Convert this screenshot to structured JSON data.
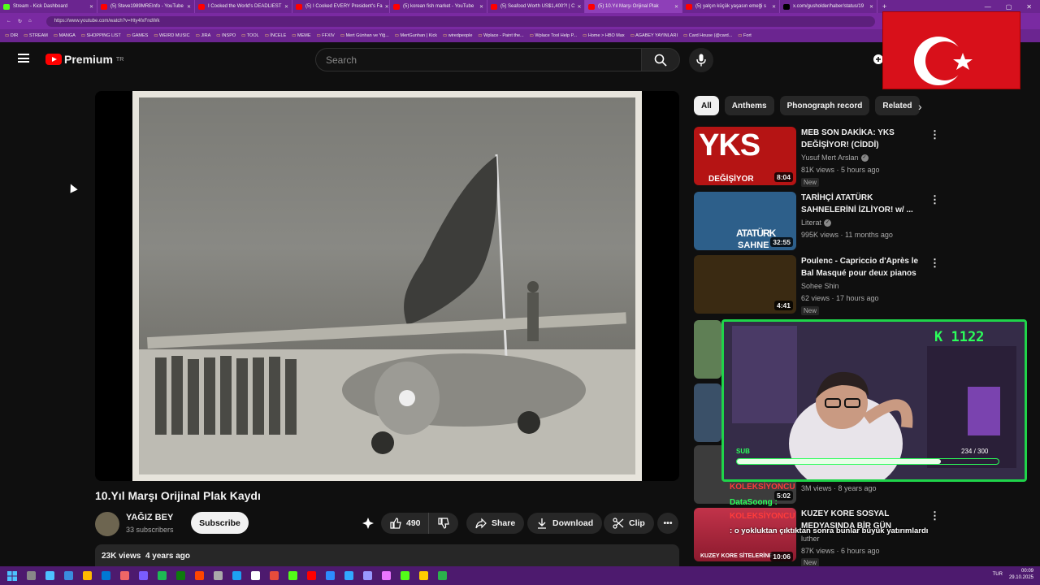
{
  "browser": {
    "tabs": [
      {
        "title": "Stream - Kick Dashboard",
        "color": "#53fc18"
      },
      {
        "title": "(5) Steve1989MREInfo - YouTube",
        "color": "#ff0000"
      },
      {
        "title": "I Cooked the World's DEADLIEST",
        "color": "#ff0000"
      },
      {
        "title": "(5) I Cooked EVERY President's Fa",
        "color": "#ff0000"
      },
      {
        "title": "(5) korean fish market - YouTube",
        "color": "#ff0000"
      },
      {
        "title": "(5) Seafood Worth US$1,400?! | C",
        "color": "#ff0000"
      },
      {
        "title": "(5) 10.Yıl Marşı Orijinal Plak",
        "color": "#ff0000"
      },
      {
        "title": "(5) yalçın küçük yaşasın emeği s",
        "color": "#ff0000"
      },
      {
        "title": "x.com/gusholder/haber/status/19",
        "color": "#000000"
      }
    ],
    "active_tab": 6,
    "url": "https://www.youtube.com/watch?v=Hty4fxFndWk",
    "bookmarks": [
      "DIR",
      "STREAM",
      "MANGA",
      "SHOPPING LIST",
      "GAMES",
      "WEIRD MUSIC",
      "JIRA",
      "INSPO",
      "TOOL",
      "İNCELE",
      "MEME",
      "FFXIV",
      "Mert Günhan ve Yiğ...",
      "MertGunhan | Kick",
      "wiredpeople",
      "Wplace - Paint the...",
      "Wplace Tool Help P...",
      "Home > HBO Max",
      "AGABEY YAYINLARI",
      "Card House (@card...",
      "Fort"
    ]
  },
  "youtube": {
    "logo_text": "Premium",
    "logo_region": "TR",
    "search_placeholder": "Search"
  },
  "video": {
    "title": "10.Yıl Marşı Orijinal Plak Kaydı",
    "channel": "YAĞIZ BEY",
    "subscribers": "33 subscribers",
    "subscribe_label": "Subscribe",
    "likes": "490",
    "share_label": "Share",
    "download_label": "Download",
    "clip_label": "Clip",
    "views": "23K views",
    "age": "4 years ago"
  },
  "chips": [
    "All",
    "Anthems",
    "Phonograph record",
    "Related"
  ],
  "recommendations": [
    {
      "title": "MEB SON DAKİKA: YKS DEĞİŞİYOR! (CİDDİ)",
      "channel": "Yusuf Mert Arslan",
      "verified": true,
      "views": "81K views",
      "age": "5 hours ago",
      "badge": "New",
      "duration": "8:04",
      "thumb_text": "YKS",
      "thumb_sub": "DEĞİŞİYOR",
      "thumb_color": "#b51414"
    },
    {
      "title": "TARİHÇİ ATATÜRK SAHNELERİNİ İZLİYOR! w/ ...",
      "channel": "Literat",
      "verified": true,
      "views": "995K views",
      "age": "11 months ago",
      "badge": "",
      "duration": "32:55",
      "thumb_text": "ATATÜRK",
      "thumb_sub": "SAHNE",
      "thumb_color": "#2d5f8a"
    },
    {
      "title": "Poulenc - Capriccio d'Après le Bal Masqué pour deux pianos",
      "channel": "Sohee Shin",
      "verified": false,
      "views": "62 views",
      "age": "17 hours ago",
      "badge": "New",
      "duration": "4:41",
      "thumb_text": "",
      "thumb_sub": "",
      "thumb_color": "#3a2a12"
    }
  ],
  "partial_recs": [
    {
      "views": "3M views",
      "age": "8 years ago",
      "duration": "5:02"
    },
    {
      "title": "KUZEY KORE SOSYAL MEDYASINDA BİR GÜN",
      "channel": "luther",
      "views": "87K views",
      "age": "6 hours ago",
      "badge": "New",
      "duration": "10:06",
      "thumb_sub": "KUZEY KORE SİTELERİNE"
    }
  ],
  "stream_overlay": {
    "kick_count": "K 1122",
    "sub_label": "SUB",
    "sub_progress_text": "234 / 300",
    "sub_progress": 0.78,
    "chat": [
      {
        "user": "KOLEKSİYONCU",
        "color": "#ff3b3b"
      },
      {
        "user": "DataSoong :",
        "color": "#2bff5a"
      },
      {
        "user": "KOLEKSİYONCU",
        "color": "#ff3b3b"
      }
    ],
    "message": "o yokluktan çıktıktan sonra bunlar büyük yatırımlardı"
  },
  "taskbar": {
    "lang": "TUR",
    "time": "00:09",
    "date": "29.10.2025"
  },
  "colors": {
    "browser_chrome": "#6b2590",
    "youtube_red": "#ff0000",
    "overlay_green": "#1fd44a",
    "flag_red": "#d8101a"
  }
}
